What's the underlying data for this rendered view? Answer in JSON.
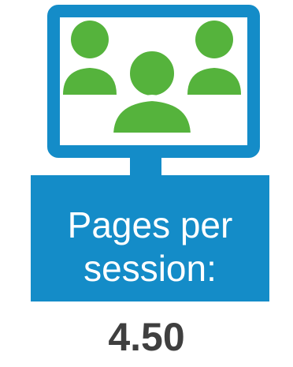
{
  "colors": {
    "frame_blue": "#148cc8",
    "screen_green": "#55b33c",
    "text_white": "#ffffff",
    "value_gray": "#3f3f3f"
  },
  "icon": "presentation-monitor-users-icon",
  "stat": {
    "label_line1": "Pages per",
    "label_line2": "session:",
    "value": "4.50"
  }
}
